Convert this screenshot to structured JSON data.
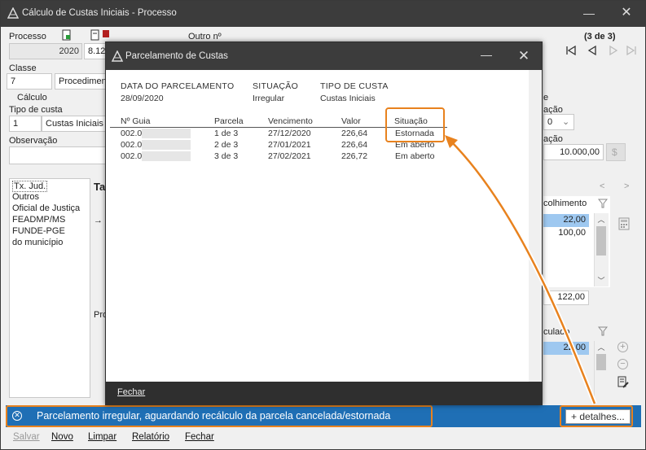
{
  "window": {
    "title": "Cálculo de Custas Iniciais - Processo",
    "minimize": "—",
    "close": "✕"
  },
  "form": {
    "processo_label": "Processo",
    "processo_value": "2020",
    "processo_value2": "8.12",
    "outro_label": "Outro nº",
    "nav_count": "(3 de 3)",
    "classe_label": "Classe",
    "classe_code": "7",
    "classe_name": "Procedimen",
    "calculo_label": "Cálculo",
    "tipo_label": "Tipo de custa",
    "tipo_code": "1",
    "tipo_name": "Custas Iniciais",
    "obs_label": "Observação",
    "right_label1": "e",
    "right_label2": "ação",
    "right_combo": "0",
    "right_label3": "ação",
    "right_value": "10.000,00"
  },
  "left_list": [
    "Tx. Jud.",
    "Outros",
    "Oficial de Justiça",
    "FEADMP/MS",
    "FUNDE-PGE",
    "do município"
  ],
  "upper_grid": {
    "tab_label": "Ta",
    "col_header": "colhimento",
    "values": [
      "22,00",
      "100,00"
    ],
    "total": "122,00",
    "pager_prev": "<",
    "pager_next": ">"
  },
  "lower_grid": {
    "label": "Pro",
    "col_header": "culado",
    "values": [
      "22,00"
    ]
  },
  "modal": {
    "title": "Parcelamento de Custas",
    "minimize": "—",
    "close": "✕",
    "header": {
      "date_label": "DATA DO PARCELAMENTO",
      "date_value": "28/09/2020",
      "status_label": "SITUAÇÃO",
      "status_value": "Irregular",
      "type_label": "TIPO DE CUSTA",
      "type_value": "Custas Iniciais"
    },
    "columns": [
      "Nº Guia",
      "Parcela",
      "Vencimento",
      "Valor",
      "Situação"
    ],
    "rows": [
      {
        "guia": "002.0",
        "parcela": "1 de 3",
        "vencimento": "27/12/2020",
        "valor": "226,64",
        "situacao": "Estornada"
      },
      {
        "guia": "002.0",
        "parcela": "2 de 3",
        "vencimento": "27/01/2021",
        "valor": "226,64",
        "situacao": "Em aberto"
      },
      {
        "guia": "002.0",
        "parcela": "3 de 3",
        "vencimento": "27/02/2021",
        "valor": "226,72",
        "situacao": "Em aberto"
      }
    ],
    "footer_close": "Fechar"
  },
  "status": {
    "message": "Parcelamento irregular, aguardando recálculo da parcela cancelada/estornada",
    "details": "+ detalhes..."
  },
  "bottom": {
    "salvar": "Salvar",
    "novo": "Novo",
    "limpar": "Limpar",
    "relatorio": "Relatório",
    "fechar": "Fechar"
  },
  "colors": {
    "accent_orange": "#e8821e",
    "status_blue": "#1f6fb5",
    "title_dark": "#3c3c3c",
    "selection": "#9ec8f0"
  }
}
